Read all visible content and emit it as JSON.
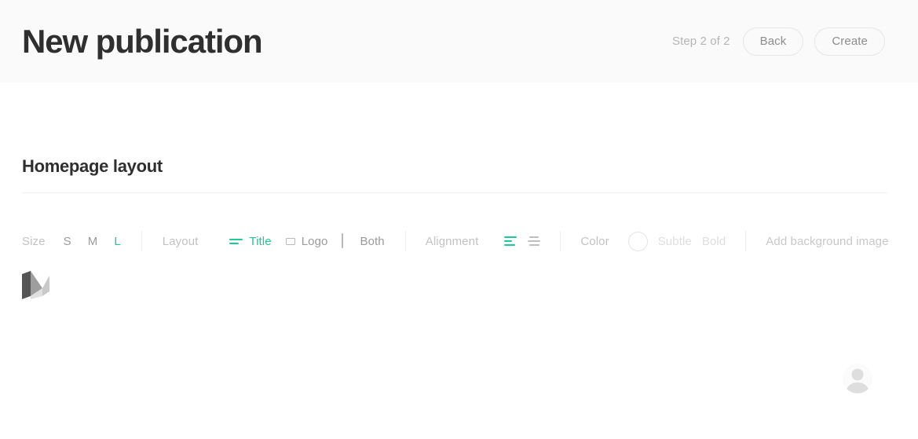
{
  "header": {
    "title": "New publication",
    "step_indicator": "Step 2 of 2",
    "back_label": "Back",
    "create_label": "Create"
  },
  "section": {
    "title": "Homepage layout"
  },
  "toolbar": {
    "size": {
      "label": "Size",
      "options": [
        {
          "label": "S",
          "selected": false
        },
        {
          "label": "M",
          "selected": false
        },
        {
          "label": "L",
          "selected": true
        }
      ]
    },
    "layout": {
      "label": "Layout",
      "options": [
        {
          "label": "Title",
          "icon": "title-lines-icon",
          "selected": true
        },
        {
          "label": "Logo",
          "icon": "logo-rect-icon",
          "selected": false
        },
        {
          "label": "Both",
          "icon": "logo-and-title-icon",
          "selected": false
        }
      ]
    },
    "alignment": {
      "label": "Alignment",
      "options": [
        {
          "icon": "align-left-icon",
          "selected": true
        },
        {
          "icon": "align-center-icon",
          "selected": false
        }
      ]
    },
    "color": {
      "label": "Color",
      "swatch_icon": "color-swatch-icon",
      "options": [
        {
          "label": "Subtle",
          "disabled": true
        },
        {
          "label": "Bold",
          "disabled": true
        }
      ]
    },
    "background": {
      "add_image_label": "Add background image"
    }
  },
  "preview": {
    "logo_icon": "medium-m-logo",
    "avatar_icon": "user-avatar-placeholder"
  },
  "colors": {
    "accent_green": "#1ec997",
    "header_bg": "#fafafa",
    "text_dark": "#2f2f2f",
    "text_muted": "#9b9b9b",
    "text_light": "#c2c2c2",
    "border": "#e6e6e6"
  }
}
